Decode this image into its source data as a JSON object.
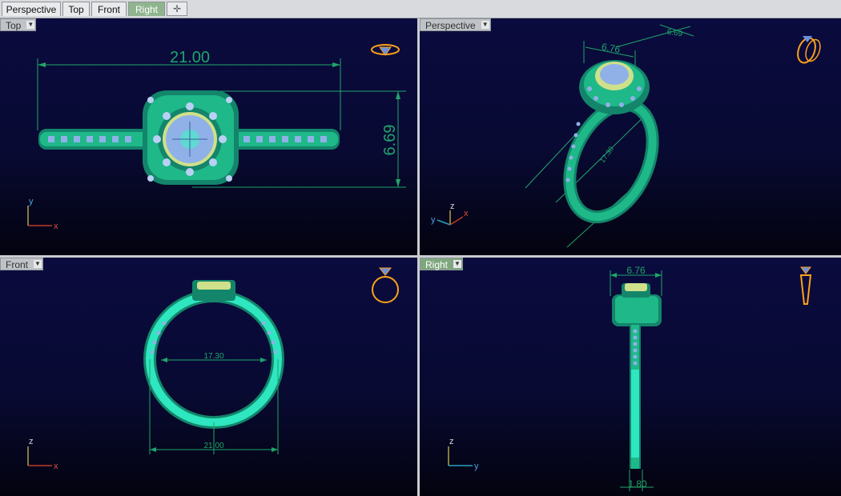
{
  "tabs": [
    {
      "label": "Perspective",
      "active": false
    },
    {
      "label": "Top",
      "active": false
    },
    {
      "label": "Front",
      "active": false
    },
    {
      "label": "Right",
      "active": true
    }
  ],
  "add_tab_icon": "plus-icon",
  "viewports": {
    "top": {
      "label": "Top",
      "dims": {
        "length": "21.00",
        "width": "6.69"
      },
      "axes": {
        "v": "y",
        "h": "x"
      }
    },
    "perspective": {
      "label": "Perspective",
      "dims": {
        "top": "6.76",
        "diag": "6.69",
        "diameter": "17.30"
      },
      "axes": {
        "z": "z",
        "x": "x",
        "y": "y"
      }
    },
    "front": {
      "label": "Front",
      "dims": {
        "inner": "17.30",
        "outer": "21.00"
      },
      "axes": {
        "v": "z",
        "h": "x"
      }
    },
    "right": {
      "label": "Right",
      "dims": {
        "top": "6.76",
        "band": "1.80"
      },
      "axes": {
        "v": "z",
        "h": "y"
      }
    }
  },
  "colors": {
    "metal": "#1fb889",
    "dimension": "#1fa56a",
    "stone": "#8fb1e8",
    "center_stone": "#cfe08a",
    "nav_icon": "#ffa21a",
    "active_tab": "#8fb58f"
  }
}
